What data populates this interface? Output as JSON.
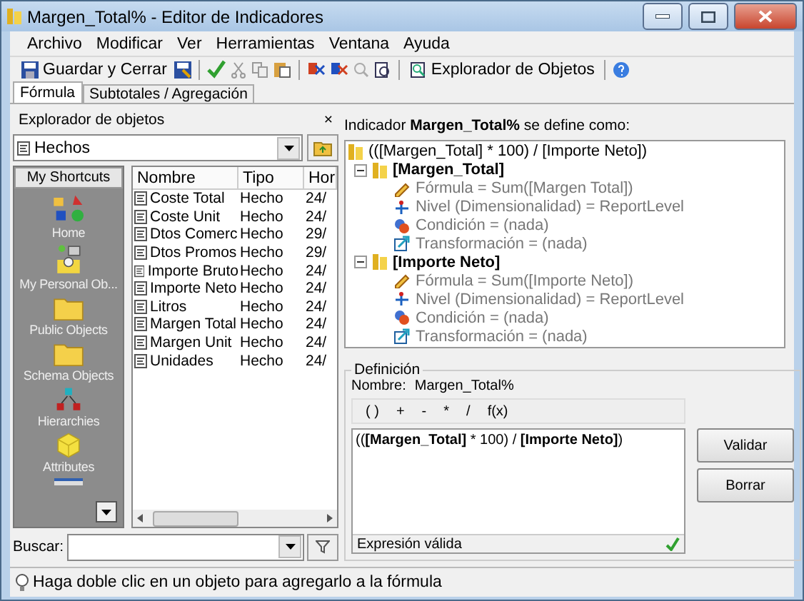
{
  "window": {
    "title": "Margen_Total% - Editor de Indicadores"
  },
  "menu": [
    "Archivo",
    "Modificar",
    "Ver",
    "Herramientas",
    "Ventana",
    "Ayuda"
  ],
  "toolbar": [
    {
      "kind": "save",
      "label": "Guardar y Cerrar"
    },
    {
      "kind": "explorer",
      "label": "Explorador de Objetos"
    }
  ],
  "tabs": [
    {
      "label": "Fórmula",
      "selected": true
    },
    {
      "label": "Subtotales / Agregación",
      "selected": false
    }
  ],
  "explorer": {
    "title": "Explorador de objetos",
    "close": "×",
    "combo": "Hechos",
    "shortcuts": {
      "header": "My Shortcuts",
      "items": [
        {
          "kind": "home",
          "label": "Home"
        },
        {
          "kind": "personal",
          "label": "My Personal Ob..."
        },
        {
          "kind": "folder",
          "label": "Public Objects"
        },
        {
          "kind": "folder",
          "label": "Schema Objects"
        },
        {
          "kind": "hierarchy",
          "label": "Hierarchies"
        },
        {
          "kind": "attribute",
          "label": "Attributes"
        }
      ]
    },
    "columns": [
      "Nombre",
      "Tipo",
      "Hor"
    ],
    "rows": [
      {
        "cells": [
          "Coste Total",
          "Hecho",
          "24/"
        ]
      },
      {
        "cells": [
          "Coste Unit",
          "Hecho",
          "24/"
        ]
      },
      {
        "cells": [
          "Dtos Comerc",
          "Hecho",
          "29/"
        ]
      },
      {
        "cells": [
          "Dtos Promos",
          "Hecho",
          "29/"
        ]
      },
      {
        "cells": [
          "Importe Bruto",
          "Hecho",
          "24/"
        ]
      },
      {
        "cells": [
          "Importe Neto",
          "Hecho",
          "24/"
        ]
      },
      {
        "cells": [
          "Litros",
          "Hecho",
          "24/"
        ]
      },
      {
        "cells": [
          "Margen Total",
          "Hecho",
          "24/"
        ]
      },
      {
        "cells": [
          "Margen Unit",
          "Hecho",
          "24/"
        ]
      },
      {
        "cells": [
          "Unidades",
          "Hecho",
          "24/"
        ]
      }
    ],
    "search_label": "Buscar:"
  },
  "definition_heading": "Indicador **Margen_Total%**  se define como:",
  "tree": {
    "root": "(([Margen_Total] * 100) / [Importe Neto])",
    "children": [
      {
        "label": "[Margen_Total]",
        "expanded": true,
        "children": [
          {
            "kind": "formula",
            "label": "Fórmula = Sum([Margen Total])"
          },
          {
            "kind": "level",
            "label": "Nivel (Dimensionalidad) = ReportLevel"
          },
          {
            "kind": "condition",
            "label": "Condición = (nada)"
          },
          {
            "kind": "transform",
            "label": "Transformación = (nada)"
          }
        ]
      },
      {
        "label": "[Importe Neto]",
        "expanded": true,
        "children": [
          {
            "kind": "formula",
            "label": "Fórmula = Sum([Importe Neto])"
          },
          {
            "kind": "level",
            "label": "Nivel (Dimensionalidad) = ReportLevel"
          },
          {
            "kind": "condition",
            "label": "Condición = (nada)"
          },
          {
            "kind": "transform",
            "label": "Transformación = (nada)"
          }
        ]
      }
    ]
  },
  "definition": {
    "legend": "Definición",
    "name_label": "Nombre:",
    "name": "Margen_Total%",
    "operators": [
      "( )",
      "+",
      "-",
      "*",
      "/",
      "f(x)"
    ],
    "expression": "((**[Margen_Total]** * 100) / **[Importe Neto]**)",
    "status": "Expresión válida",
    "buttons": [
      "Validar",
      "Borrar"
    ]
  },
  "status_bar": "Haga doble clic en un objeto para agregarlo a la fórmula"
}
